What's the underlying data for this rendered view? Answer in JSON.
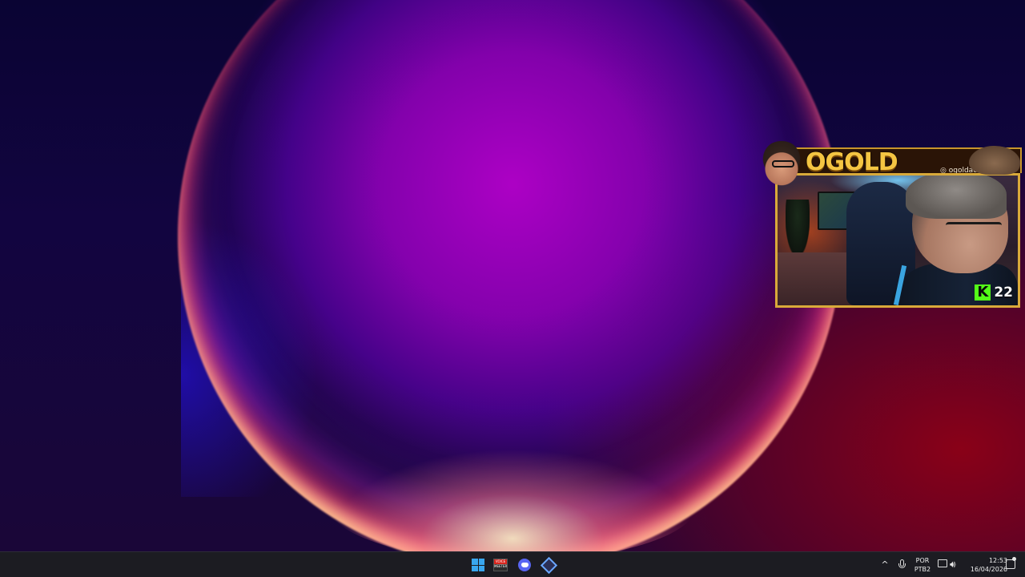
{
  "desktop": {
    "wallpaper": "windows-11-bloom-purple-sunrise"
  },
  "webcam_overlay": {
    "title": "OGOLD",
    "handle": "ogoldao",
    "handle_icon": "instagram-icon",
    "kick_logo": "K",
    "viewer_count": "22",
    "accent": "#d9aa3a",
    "title_color": "#f4c542",
    "kick_green": "#53fc18"
  },
  "taskbar": {
    "pinned_apps": [
      {
        "name": "Start",
        "icon": "windows-start-icon"
      },
      {
        "name": "VoiceMeeter",
        "icon": "voicemeeter-icon",
        "label_top": "VOICE",
        "label_bottom": "MEETER"
      },
      {
        "name": "Discord",
        "icon": "discord-icon"
      },
      {
        "name": "App",
        "icon": "diamond-app-icon"
      }
    ],
    "tray": {
      "chevron": "^",
      "language_line1": "POR",
      "language_line2": "PTB2",
      "time": "12:53",
      "date": "16/04/2026"
    },
    "accent": "#39a7f0"
  }
}
